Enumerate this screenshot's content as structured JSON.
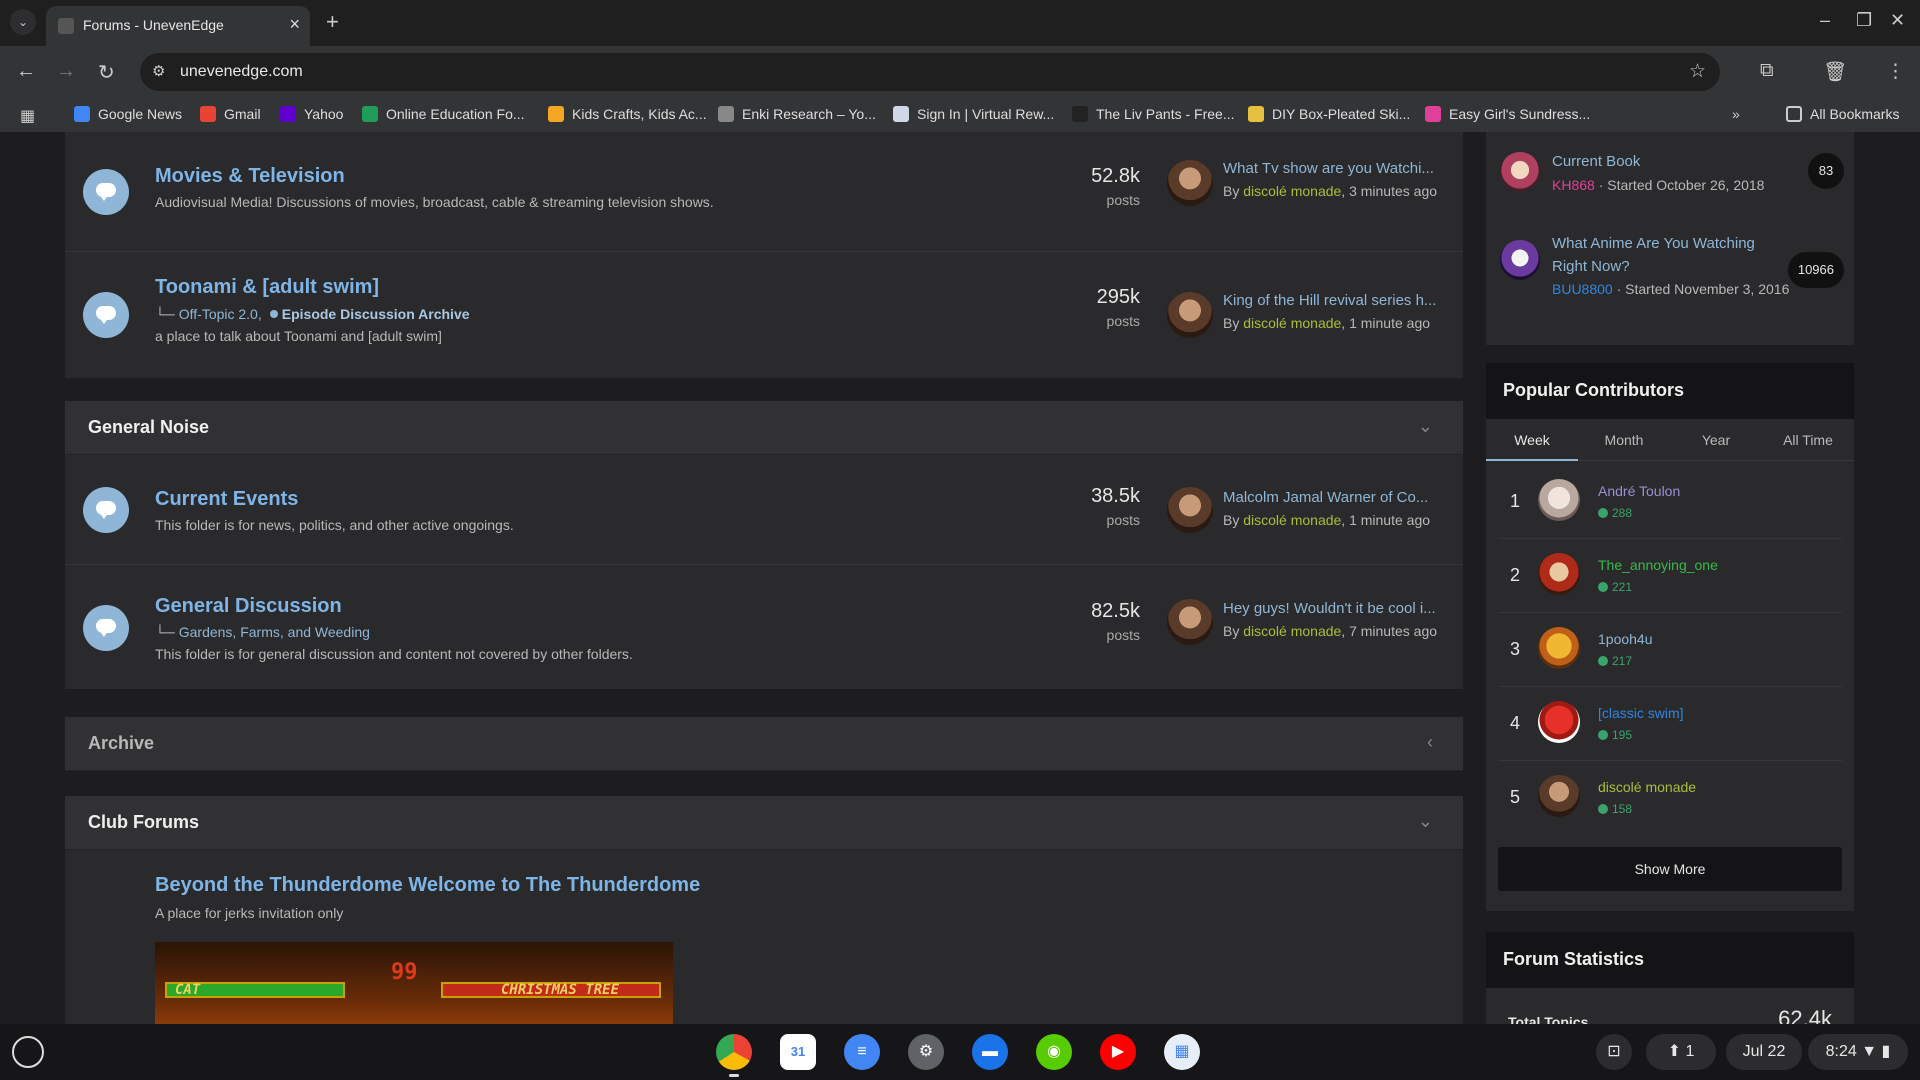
{
  "browser": {
    "tab_title": "Forums - UnevenEdge",
    "url": "unevenedge.com",
    "bookmarks": [
      {
        "label": "Google News",
        "color": "#4285f4"
      },
      {
        "label": "Gmail",
        "color": "#ea4335"
      },
      {
        "label": "Yahoo",
        "color": "#6001d2"
      },
      {
        "label": "Online Education Fo...",
        "color": "#1e9e5a"
      },
      {
        "label": "Kids Crafts, Kids Ac...",
        "color": "#f5a623"
      },
      {
        "label": "Enki Research – Yo...",
        "color": "#888888"
      },
      {
        "label": "Sign In | Virtual Rew...",
        "color": "#d0d8e8"
      },
      {
        "label": "The Liv Pants - Free...",
        "color": "#222222"
      },
      {
        "label": "DIY Box-Pleated Ski...",
        "color": "#e8c040"
      },
      {
        "label": "Easy Girl's Sundress...",
        "color": "#e0409a"
      }
    ],
    "all_bookmarks": "All Bookmarks"
  },
  "forums_top": [
    {
      "title": "Movies & Television",
      "description": "Audiovisual Media! Discussions of movies, broadcast, cable & streaming television shows.",
      "count": "52.8k",
      "count_label": "posts",
      "last_title": "What Tv show are you Watchi...",
      "last_by": "By",
      "last_user": "discolé monade",
      "last_time": ", 3 minutes ago"
    },
    {
      "title": "Toonami & [adult swim]",
      "sub_prefix": "└─",
      "sub_link": "Off-Topic 2.0,",
      "sub_archive": "Episode Discussion Archive",
      "description": "a place to talk about Toonami and [adult swim]",
      "count": "295k",
      "count_label": "posts",
      "last_title": "King of the Hill revival series h...",
      "last_by": "By",
      "last_user": "discolé monade",
      "last_time": ", 1 minute ago"
    }
  ],
  "general_noise": {
    "title": "General Noise",
    "forums": [
      {
        "title": "Current Events",
        "description": "This folder is for news, politics, and other active ongoings.",
        "count": "38.5k",
        "count_label": "posts",
        "last_title": "Malcolm Jamal Warner of Co...",
        "last_by": "By",
        "last_user": "discolé monade",
        "last_time": ", 1 minute ago"
      },
      {
        "title": "General Discussion",
        "sub_prefix": "└─",
        "sub_link": "Gardens, Farms, and Weeding",
        "description": "This folder is for general discussion and content not covered by other folders.",
        "count": "82.5k",
        "count_label": "posts",
        "last_title": "Hey guys! Wouldn't it be cool i...",
        "last_by": "By",
        "last_user": "discolé monade",
        "last_time": ", 7 minutes ago"
      }
    ]
  },
  "archive": {
    "title": "Archive"
  },
  "club_forums": {
    "title": "Club Forums",
    "club_title": "Beyond the Thunderdome Welcome to The Thunderdome",
    "club_desc": "A place for jerks invitation only",
    "img_left": "CAT",
    "img_right": "CHRISTMAS TREE",
    "img_num": "99"
  },
  "sidebar_topics": [
    {
      "title": "Current Book",
      "user": "KH868",
      "meta": " · Started October 26, 2018",
      "count": "83",
      "user_color": "#e0409a"
    },
    {
      "title": "What Anime Are You Watching Right Now?",
      "user": "BUU8800",
      "meta": " · Started November 3, 2016",
      "count": "10966",
      "user_color": "#2e86e0"
    }
  ],
  "popular_contributors": {
    "title": "Popular Contributors",
    "tabs": [
      "Week",
      "Month",
      "Year",
      "All Time"
    ],
    "rows": [
      {
        "rank": "1",
        "name": "André Toulon",
        "score": "288",
        "color": "#9b8fd6"
      },
      {
        "rank": "2",
        "name": "The_annoying_one",
        "score": "221",
        "color": "#3ab84a"
      },
      {
        "rank": "3",
        "name": "1pooh4u",
        "score": "217",
        "color": "#8fb6d6"
      },
      {
        "rank": "4",
        "name": "[classic swim]",
        "score": "195",
        "color": "#2e86e0"
      },
      {
        "rank": "5",
        "name": "discolé monade",
        "score": "158",
        "color": "#a8bf3a"
      }
    ],
    "show_more": "Show More"
  },
  "forum_statistics": {
    "title": "Forum Statistics",
    "label": "Total Topics",
    "value": "62.4k"
  },
  "shelf": {
    "date": "Jul 22",
    "time": "8:24",
    "notif_count": "1"
  }
}
